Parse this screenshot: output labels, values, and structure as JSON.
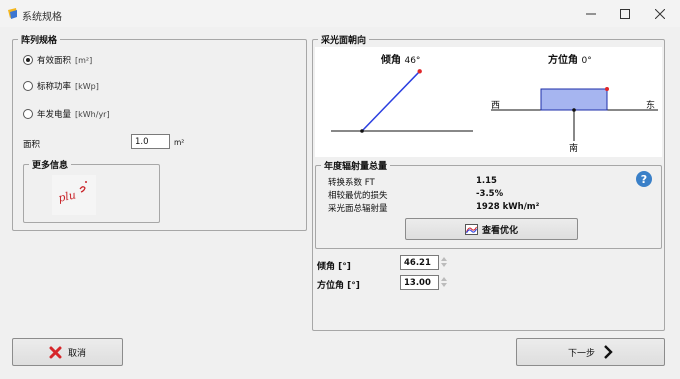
{
  "window": {
    "title": "系统规格",
    "controls": [
      "minimize-icon",
      "maximize-icon",
      "close-icon"
    ]
  },
  "array_spec": {
    "title": "阵列规格",
    "options": [
      {
        "label": "有效面积",
        "unit": "[m²]",
        "selected": true
      },
      {
        "label": "标称功率",
        "unit": "[kWp]",
        "selected": false
      },
      {
        "label": "年发电量",
        "unit": "[kWh/yr]",
        "selected": false
      }
    ],
    "area_label": "面积",
    "area_value": "1.0",
    "area_unit": "m²",
    "more_info": {
      "title": "更多信息",
      "logo_text": "plus"
    }
  },
  "orientation": {
    "title": "采光面朝向",
    "tilt": {
      "label": "倾角",
      "value_text": "46°",
      "degrees": 46
    },
    "azimuth": {
      "label": "方位角",
      "value_text": "0°",
      "degrees": 0,
      "west": "西",
      "east": "东",
      "south": "南"
    },
    "irradiation": {
      "title": "年度辐射量总量",
      "rows": [
        {
          "label": "转换系数 FT",
          "value": "1.15"
        },
        {
          "label": "相较最优的损失",
          "value": "-3.5%"
        },
        {
          "label": "采光面总辐射量",
          "value": "1928 kWh/m²"
        }
      ],
      "optimize_button": "查看优化"
    },
    "tilt_field": {
      "label": "倾角 [°]",
      "value": "46.21"
    },
    "azimuth_field": {
      "label": "方位角 [°]",
      "value": "13.00"
    }
  },
  "footer": {
    "cancel": "取消",
    "next": "下一步"
  },
  "colors": {
    "tilt_line": "#2b3fe0",
    "marker": "#e0262a",
    "azimuth_panel": "#a6b5f0",
    "help": "#3a80c8",
    "cancel_x": "#d6262a"
  }
}
